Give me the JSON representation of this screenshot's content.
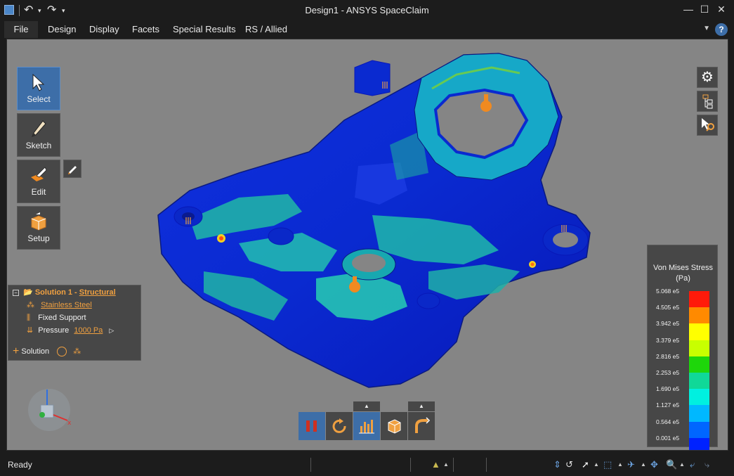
{
  "window": {
    "title": "Design1 - ANSYS SpaceClaim"
  },
  "menu": [
    "File",
    "Design",
    "Display",
    "Facets",
    "Special Results",
    "RS / Allied"
  ],
  "tools": {
    "select": "Select",
    "sketch": "Sketch",
    "edit": "Edit",
    "setup": "Setup"
  },
  "tree": {
    "solution_prefix": "Solution 1 - ",
    "solution_type": "Structural",
    "material": "Stainless Steel",
    "support": "Fixed Support",
    "pressure_label": "Pressure",
    "pressure_value": "1000 Pa",
    "add_solution": "Solution"
  },
  "legend": {
    "title": "Von Mises Stress (Pa)",
    "labels": [
      "5.068 e5",
      "4.505 e5",
      "3.942 e5",
      "3.379 e5",
      "2.816 e5",
      "2.253 e5",
      "1.690 e5",
      "1.127 e5",
      "0.564 e5",
      "0.001 e5"
    ],
    "colors": [
      "#ff1a0a",
      "#ff8a00",
      "#ffff00",
      "#c8ff00",
      "#1ed60a",
      "#10d898",
      "#00f0e0",
      "#00b8ff",
      "#0066ff",
      "#0022ff"
    ]
  },
  "status": {
    "text": "Ready"
  },
  "colors": {
    "accent": "#3d6ea8",
    "highlight": "#f0a040"
  }
}
